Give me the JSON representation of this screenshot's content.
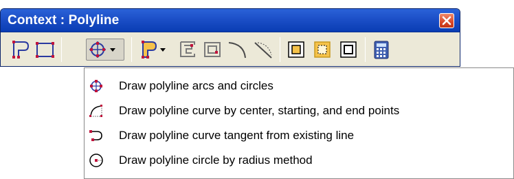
{
  "window": {
    "title": "Context : Polyline",
    "close_icon": "close-icon"
  },
  "toolbar": {
    "tools": [
      {
        "name": "polyline-edit-icon"
      },
      {
        "name": "rectangle-icon"
      },
      {
        "name": "polyline-arc-circle-dropdown-icon",
        "pressed": true
      },
      {
        "name": "polyline-fill-dropdown-icon"
      },
      {
        "name": "polyline-frame-icon"
      },
      {
        "name": "polyline-offset-frame-icon"
      },
      {
        "name": "curve-icon"
      },
      {
        "name": "curve-dotted-icon"
      },
      {
        "name": "square-inner-icon"
      },
      {
        "name": "square-dotted-icon"
      },
      {
        "name": "square-outline-icon"
      },
      {
        "name": "calculator-icon"
      }
    ]
  },
  "menu": {
    "items": [
      {
        "label": "Draw polyline arcs and circles",
        "icon": "arcs-circles-icon"
      },
      {
        "label": "Draw polyline curve by center, starting, and end points",
        "icon": "curve-center-icon"
      },
      {
        "label": "Draw polyline curve tangent from existing line",
        "icon": "curve-tangent-icon"
      },
      {
        "label": "Draw polyline circle by radius method",
        "icon": "circle-radius-icon"
      }
    ]
  },
  "colors": {
    "titlebar": "#1c4fc7",
    "accent_red": "#c0143c",
    "toolbar_bg": "#ece9d8"
  }
}
